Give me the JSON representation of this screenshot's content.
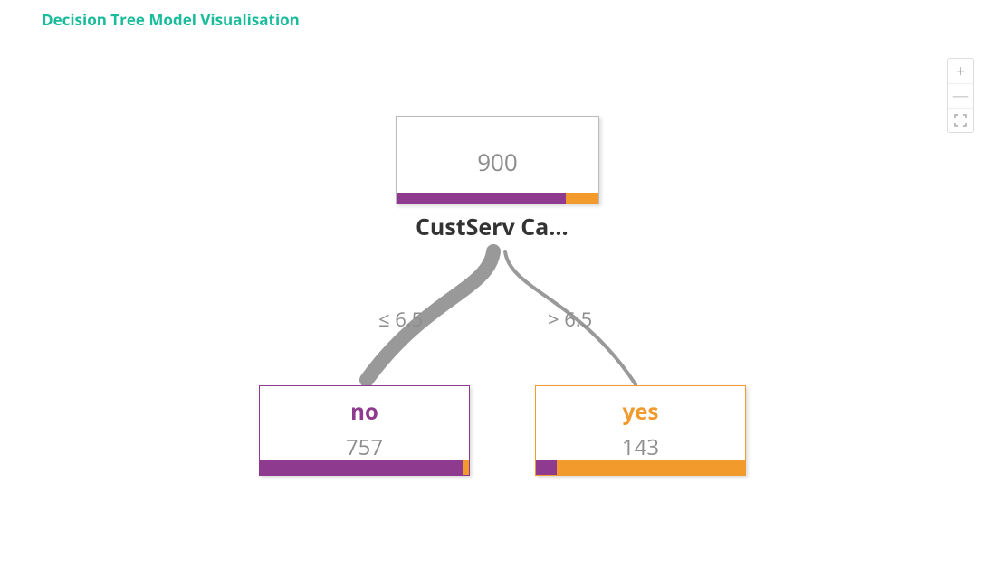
{
  "title": "Decision Tree Model Visualisation",
  "controls": {
    "zoom_in": "+",
    "zoom_out": "—",
    "fullscreen": "⛶"
  },
  "tree": {
    "root": {
      "count": "900",
      "bar_purple_pct": 84,
      "bar_orange_pct": 16
    },
    "split_feature": "CustServ Ca...",
    "edge_left": "≤ 6.5",
    "edge_right": "> 6.5",
    "leaf_left": {
      "label": "no",
      "count": "757",
      "bar_purple_pct": 97,
      "bar_orange_pct": 3
    },
    "leaf_right": {
      "label": "yes",
      "count": "143",
      "bar_purple_pct": 10,
      "bar_orange_pct": 90
    }
  }
}
